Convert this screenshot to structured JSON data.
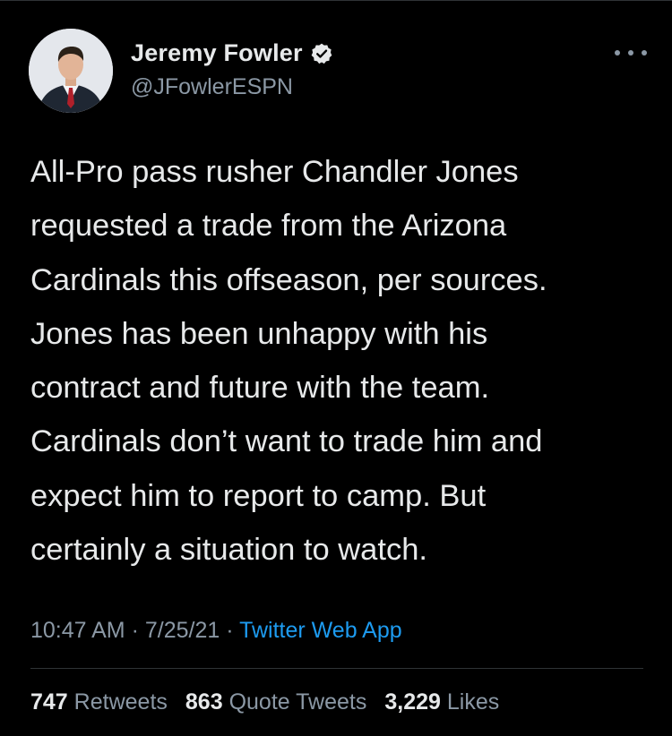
{
  "author": {
    "display_name": "Jeremy Fowler",
    "handle": "@JFowlerESPN",
    "verified": true
  },
  "tweet": {
    "lines": [
      "All-Pro pass rusher Chandler Jones",
      "requested a trade from the Arizona",
      "Cardinals this offseason, per sources.",
      "Jones has been unhappy with his",
      "contract and future with the team.",
      "Cardinals don’t want to trade him and",
      "expect him to report to camp. But",
      "certainly a situation to watch."
    ]
  },
  "meta": {
    "time": "10:47 AM",
    "separator": "·",
    "date": "7/25/21",
    "source": "Twitter Web App"
  },
  "stats": {
    "retweets_count": "747",
    "retweets_label": "Retweets",
    "quote_count": "863",
    "quote_label": "Quote Tweets",
    "likes_count": "3,229",
    "likes_label": "Likes"
  },
  "icons": {
    "verified": "verified-badge-icon",
    "more": "more-options-icon"
  },
  "colors": {
    "background": "#000000",
    "text_primary": "#e7e9ea",
    "text_secondary": "#8b98a5",
    "link": "#1d9bf0",
    "divider": "#2f3336"
  }
}
